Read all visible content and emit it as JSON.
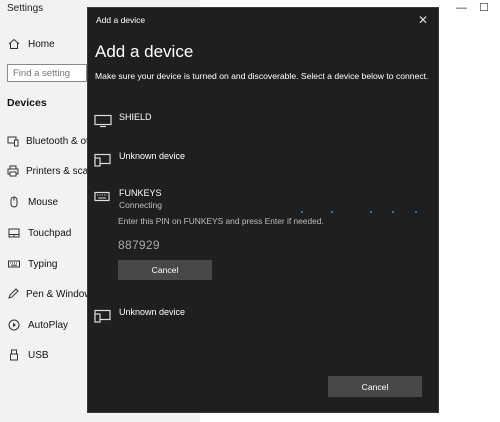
{
  "settings": {
    "title": "Settings",
    "home_label": "Home",
    "search_placeholder": "Find a setting",
    "section_heading": "Devices",
    "nav_items": [
      {
        "label": "Bluetooth & other devices",
        "icon": "bluetooth-devices-icon"
      },
      {
        "label": "Printers & scanners",
        "icon": "printer-icon"
      },
      {
        "label": "Mouse",
        "icon": "mouse-icon"
      },
      {
        "label": "Touchpad",
        "icon": "touchpad-icon"
      },
      {
        "label": "Typing",
        "icon": "keyboard-icon"
      },
      {
        "label": "Pen & Windows Ink",
        "icon": "pen-icon"
      },
      {
        "label": "AutoPlay",
        "icon": "autoplay-icon"
      },
      {
        "label": "USB",
        "icon": "usb-icon"
      }
    ],
    "window_controls": {
      "minimize": "—",
      "maximize": "☐"
    }
  },
  "dialog": {
    "title_bar": "Add a device",
    "close_glyph": "✕",
    "heading": "Add a device",
    "instructions": "Make sure your device is turned on and discoverable. Select a device below to connect.",
    "devices": [
      {
        "name": "SHIELD",
        "icon": "tv-icon"
      },
      {
        "name": "Unknown device",
        "icon": "unknown-device-icon"
      },
      {
        "name": "FUNKEYS",
        "icon": "keyboard-icon",
        "status": "Connecting"
      },
      {
        "name": "Unknown device",
        "icon": "unknown-device-icon"
      }
    ],
    "pin_instructions": "Enter this PIN on FUNKEYS and press Enter if needed.",
    "pin": "887929",
    "pin_cancel_label": "Cancel",
    "cancel_label": "Cancel"
  },
  "colors": {
    "dialog_bg": "#1f1f1f",
    "button_bg": "#484848",
    "sidebar_bg": "#f2f2f2",
    "progress_dots": "#3c8dde"
  }
}
